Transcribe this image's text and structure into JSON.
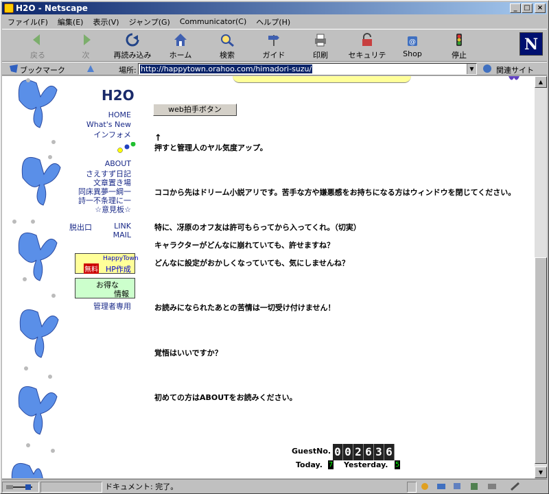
{
  "window": {
    "title": "H2O - Netscape"
  },
  "menu": [
    "ファイル(F)",
    "編集(E)",
    "表示(V)",
    "ジャンプ(G)",
    "Communicator(C)",
    "ヘルプ(H)"
  ],
  "toolbar": {
    "back": "戻る",
    "forward": "次",
    "reload": "再読み込み",
    "home": "ホーム",
    "search": "検索",
    "guide": "ガイド",
    "print": "印刷",
    "security": "セキュリティ",
    "shop": "Shop",
    "stop": "停止",
    "logo": "N"
  },
  "location": {
    "bookmarks": "ブックマーク",
    "label": "場所:",
    "url": "http://happytown.orahoo.com/himadori-suzu/",
    "related": "関連サイト"
  },
  "page": {
    "logo": "H2O",
    "nav": {
      "home": "HOME",
      "whatsnew": "What's New",
      "info": "インフォメ",
      "about": "ABOUT",
      "diary": "さえすず日記",
      "novels": "文章置き場",
      "douseki": "同床異夢一綱一",
      "poem": "詩一不条理に一",
      "board": "☆意見板☆",
      "exit": "脱出口",
      "link": "LINK",
      "mail": "MAIL",
      "admin": "管理者専用"
    },
    "banner1": {
      "brand": "HappyTown",
      "free": "無料",
      "hp": "HP作成"
    },
    "banner2": {
      "line1": "お得な",
      "line2": "情報"
    },
    "clap_button": "web拍手ボタン",
    "arrow": "↑",
    "lines": {
      "l1": "押すと管理人のヤル気度アップ。",
      "l2": "ココから先はドリーム小説アリです。苦手な方や嫌悪感をお持ちになる方はウィンドウを閉じてください。",
      "l3": "特に、冴原のオフ友は許可もらってから入ってくれ。（切実）",
      "l4": "キャラクターがどんなに崩れていても、許せますね？",
      "l5": "どんなに設定がおかしくなっていても、気にしませんね？",
      "l6": "お読みになられたあとの苦情は一切受け付けません！",
      "l7": "覚悟はいいですか？",
      "l8": "初めての方はABOUTをお読みください。"
    },
    "counter": {
      "guest_label": "GuestNo.",
      "digits": [
        "0",
        "0",
        "2",
        "6",
        "3",
        "6"
      ],
      "today_label": "Today.",
      "today": "7",
      "yesterday_label": "Yesterday.",
      "yesterday": "5"
    }
  },
  "status": {
    "text": "ドキュメント: 完了。"
  }
}
